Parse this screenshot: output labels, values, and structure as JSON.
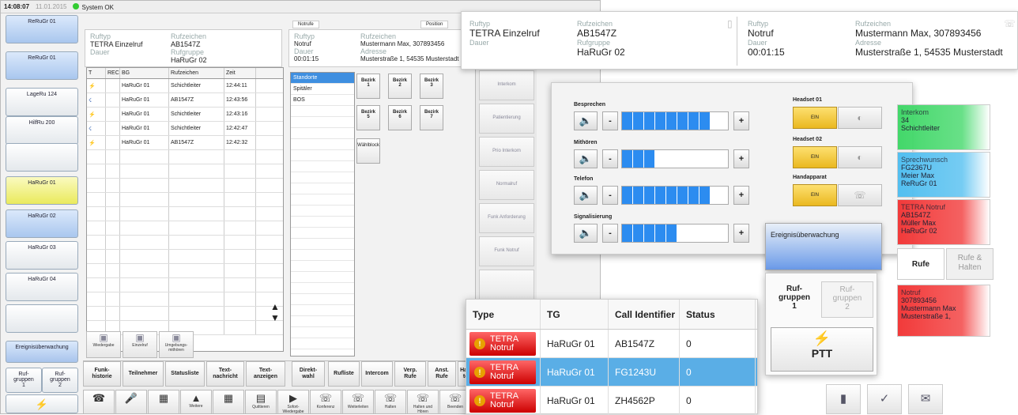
{
  "bg": {
    "status": {
      "time": "14:08:07",
      "date": "11.01.2015",
      "system": "System OK"
    },
    "left_buttons": [
      "ReRuGr 01",
      "ReRuGr 01",
      "LageRu 124",
      "HilfRu 200",
      "",
      "HaRuGr 01",
      "HaRuGr 02",
      "HaRuGr 03",
      "HaRuGr 04",
      "",
      "Ereignisüberwachung"
    ],
    "left_tabs": [
      "Ruf-\ngruppen\n1",
      "Ruf-\ngruppen\n2"
    ],
    "top1": {
      "ruftyp_lbl": "Ruftyp",
      "ruftyp": "TETRA Einzelruf",
      "rz_lbl": "Rufzeichen",
      "rz": "AB1547Z",
      "dauer_lbl": "Dauer",
      "rg_lbl": "Rufgruppe",
      "rg": "HaRuGr 02"
    },
    "top2": {
      "ruftyp_lbl": "Ruftyp",
      "ruftyp": "Notruf",
      "dauer_lbl": "Dauer",
      "dauer": "00:01:15",
      "rz_lbl": "Rufzeichen",
      "rz": "Mustermann Max, 307893456",
      "adr_lbl": "Adresse",
      "adr": "Musterstraße 1, 54535 Musterstadt",
      "tab_label": "Notrufe",
      "tab2": "Position"
    },
    "grid_cols": [
      "T",
      "REC",
      "BG",
      "Rufzeichen",
      "Zeit"
    ],
    "grid_rows": [
      {
        "bg": "HaRuGr 01",
        "rz": "Schichtleiter",
        "zeit": "12:44:11"
      },
      {
        "bg": "HaRuGr 01",
        "rz": "AB1547Z",
        "zeit": "12:43:56"
      },
      {
        "bg": "HaRuGr 01",
        "rz": "Schichtleiter",
        "zeit": "12:43:16"
      },
      {
        "bg": "HaRuGr 01",
        "rz": "Schichtleiter",
        "zeit": "12:42:47"
      },
      {
        "bg": "HaRuGr 01",
        "rz": "AB1547Z",
        "zeit": "12:42:32"
      }
    ],
    "grid_btns": [
      "Wiedergabe",
      "Einzelruf",
      "Umgebungs-\nmithören"
    ],
    "list": [
      "Standorte",
      "Spitäler",
      "BOS"
    ],
    "bezirk": [
      "Bezirk\n1",
      "Bezirk\n2",
      "Bezirk\n3",
      "Bezirk\n5",
      "Bezirk\n6",
      "Bezirk\n7",
      "Wählblock"
    ],
    "mid": [
      "Interkom",
      "Patientierung",
      "Prio Interkom",
      "Normalruf",
      "Funk Anforderung",
      "Funk Notruf"
    ],
    "tabs": [
      "Funk-\nhistorie",
      "Teilnehmer",
      "Statusliste",
      "Text-\nnachricht",
      "Text-\nanzeigen",
      "Direkt-\nwahl",
      "Rufliste",
      "Intercom",
      "Verp.\nRufe",
      "Anst.\nRufe",
      "Hauptl.\ntech."
    ],
    "icons": [
      {
        "i": "phone-out-icon",
        "g": "☎",
        "l": ""
      },
      {
        "i": "mic-icon",
        "g": "🎤",
        "l": ""
      },
      {
        "i": "keypad-icon",
        "g": "▦",
        "l": ""
      },
      {
        "i": "up-icon",
        "g": "▲",
        "l": "Weitere"
      },
      {
        "i": "grid-icon",
        "g": "▦",
        "l": ""
      },
      {
        "i": "print-icon",
        "g": "▤",
        "l": "Quittieren"
      },
      {
        "i": "play-icon",
        "g": "▶",
        "l": "Sofort-\nWiedergabe"
      },
      {
        "i": "handset-icon",
        "g": "☏",
        "l": "Konferenz"
      },
      {
        "i": "handset2-icon",
        "g": "☏",
        "l": "Weiterleiten"
      },
      {
        "i": "hold-icon",
        "g": "☏",
        "l": "Halten"
      },
      {
        "i": "hold2-icon",
        "g": "☏",
        "l": "Halten und\nHören"
      },
      {
        "i": "end-icon",
        "g": "☏",
        "l": "Beenden"
      }
    ]
  },
  "callinfo": {
    "c1": {
      "ruftyp_lbl": "Ruftyp",
      "ruftyp": "TETRA Einzelruf",
      "dauer_lbl": "Dauer",
      "rz_lbl": "Rufzeichen",
      "rz": "AB1547Z",
      "rg_lbl": "Rufgruppe",
      "rg": "HaRuGr 02"
    },
    "c2": {
      "ruftyp_lbl": "Ruftyp",
      "ruftyp": "Notruf",
      "dauer_lbl": "Dauer",
      "dauer": "00:01:15",
      "rz_lbl": "Rufzeichen",
      "rz": "Mustermann Max, 307893456",
      "adr_lbl": "Adresse",
      "adr": "Musterstraße 1, 54535 Musterstadt"
    }
  },
  "audio": {
    "rows": [
      {
        "label": "Besprechen",
        "level": 0.81
      },
      {
        "label": "Mithören",
        "level": 0.28
      },
      {
        "label": "Telefon",
        "level": 0.81
      },
      {
        "label": "Signalisierung",
        "level": 0.53
      }
    ],
    "headsets": [
      {
        "label": "Headset 01",
        "on": "EIN"
      },
      {
        "label": "Headset 02",
        "on": "EIN"
      },
      {
        "label": "Handapparat",
        "on": "EIN"
      }
    ]
  },
  "cards": [
    {
      "title": "Interkom",
      "l1": "34",
      "l2": "Schichtleiter",
      "color": "#43d86a"
    },
    {
      "title": "Sprechwunsch",
      "l1": "FG2367U",
      "l2": "Meier Max",
      "l3": "ReRuGr 01",
      "color": "#53bff0"
    },
    {
      "title": "TETRA Notruf",
      "l1": "AB1547Z",
      "l2": "Müller Max",
      "l3": "HaRuGr 02",
      "color": "#f23a3a"
    },
    {
      "title": "Notruf",
      "l1": "307893456",
      "l2": "Mustermann Max",
      "l3": "Musterstraße 1,",
      "color": "#f23a3a"
    }
  ],
  "rtabs": {
    "rufe": "Rufe",
    "halten": "Rufe &\nHalten"
  },
  "ev": "Ereignisüberwachung",
  "ruf": {
    "tab1": "Ruf-\ngruppen\n1",
    "tab2": "Ruf-\ngruppen\n2",
    "ptt": "PTT"
  },
  "table": {
    "cols": [
      "Type",
      "TG",
      "Call Identifier",
      "Status"
    ],
    "rows": [
      {
        "type": "TETRA\nNotruf",
        "tg": "HaRuGr 01",
        "id": "AB1547Z",
        "st": "0",
        "sel": false
      },
      {
        "type": "TETRA\nNotruf",
        "tg": "HaRuGr 01",
        "id": "FG1243U",
        "st": "0",
        "sel": true
      },
      {
        "type": "TETRA\nNotruf",
        "tg": "HaRuGr 01",
        "id": "ZH4562P",
        "st": "0",
        "sel": false
      }
    ]
  }
}
